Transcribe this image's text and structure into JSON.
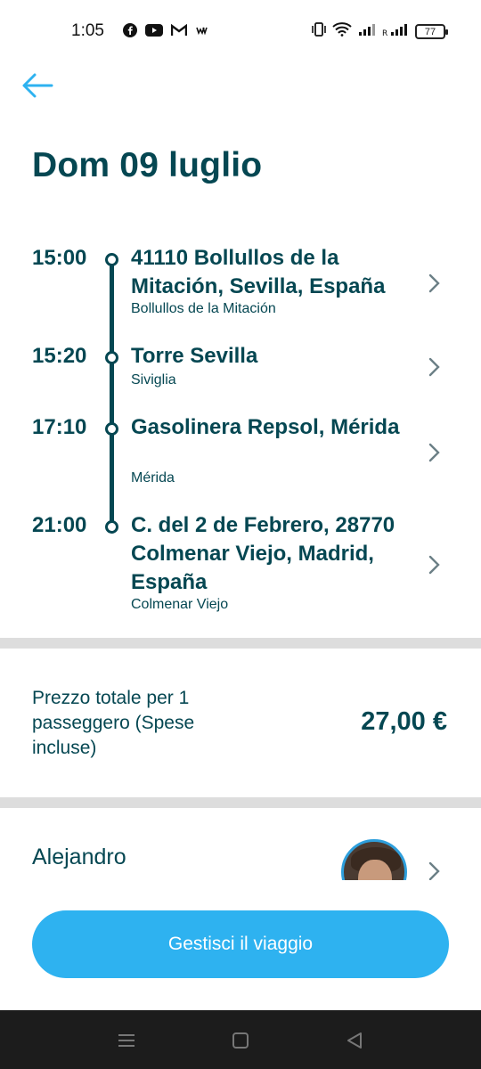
{
  "status_bar": {
    "time": "1:05",
    "battery": "77",
    "app_icons": [
      "facebook-icon",
      "youtube-icon",
      "gmail-icon",
      "w-icon"
    ]
  },
  "header": {
    "title": "Dom 09 luglio"
  },
  "stops": [
    {
      "time": "15:00",
      "address": "41110 Bollullos de la Mitación, Sevilla, España",
      "city": "Bollullos de la Mitación"
    },
    {
      "time": "15:20",
      "address": "Torre Sevilla",
      "city": "Siviglia"
    },
    {
      "time": "17:10",
      "address": "Gasolinera Repsol, Mérida",
      "city": "Mérida"
    },
    {
      "time": "21:00",
      "address": "C. del 2 de Febrero, 28770 Colmenar Viejo, Madrid, España",
      "city": "Colmenar Viejo"
    }
  ],
  "price": {
    "label": "Prezzo totale per 1 passeggero (Spese incluse)",
    "value": "27,00 €"
  },
  "driver": {
    "name": "Alejandro"
  },
  "actions": {
    "manage_label": "Gestisci il viaggio"
  },
  "colors": {
    "primary_text": "#054752",
    "accent": "#2eb2f0",
    "divider": "#dddddd"
  }
}
